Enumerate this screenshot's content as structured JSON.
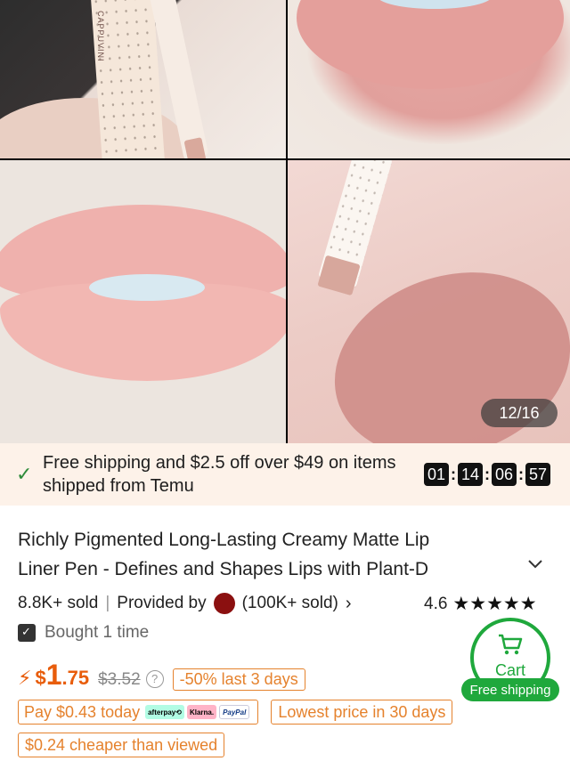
{
  "gallery": {
    "counter": "12/16",
    "box_label": "CAPPUVINI"
  },
  "shipping_banner": {
    "text": "Free shipping and $2.5 off over $49 on items shipped from Temu",
    "timer": {
      "hours": "01",
      "minutes": "14",
      "seconds": "06",
      "hundredths": "57"
    },
    "accent": "#2e8b3a"
  },
  "product": {
    "title_line1": "Richly Pigmented Long-Lasting Creamy Matte Lip",
    "title_line2": "Liner Pen - Defines and Shapes Lips with Plant-D",
    "sold": "8.8K+ sold",
    "provided_by": "Provided by",
    "store_sold": "(100K+ sold)",
    "rating": "4.6",
    "stars": "★★★★★",
    "bought": "Bought 1 time"
  },
  "price": {
    "currency": "$",
    "integer": "1",
    "decimal": ".75",
    "original": "$3.52",
    "discount_tag": "-50% last 3 days",
    "pay_today": "Pay $0.43 today",
    "afterpay": "afterpay⟲",
    "klarna": "Klarna.",
    "paypal": "PayPal",
    "lowest": "Lowest price in 30 days",
    "cheaper": "$0.24 cheaper than viewed",
    "accent": "#e5822d"
  },
  "cart": {
    "label": "Cart",
    "free_shipping": "Free shipping",
    "color": "#1fa83c"
  }
}
